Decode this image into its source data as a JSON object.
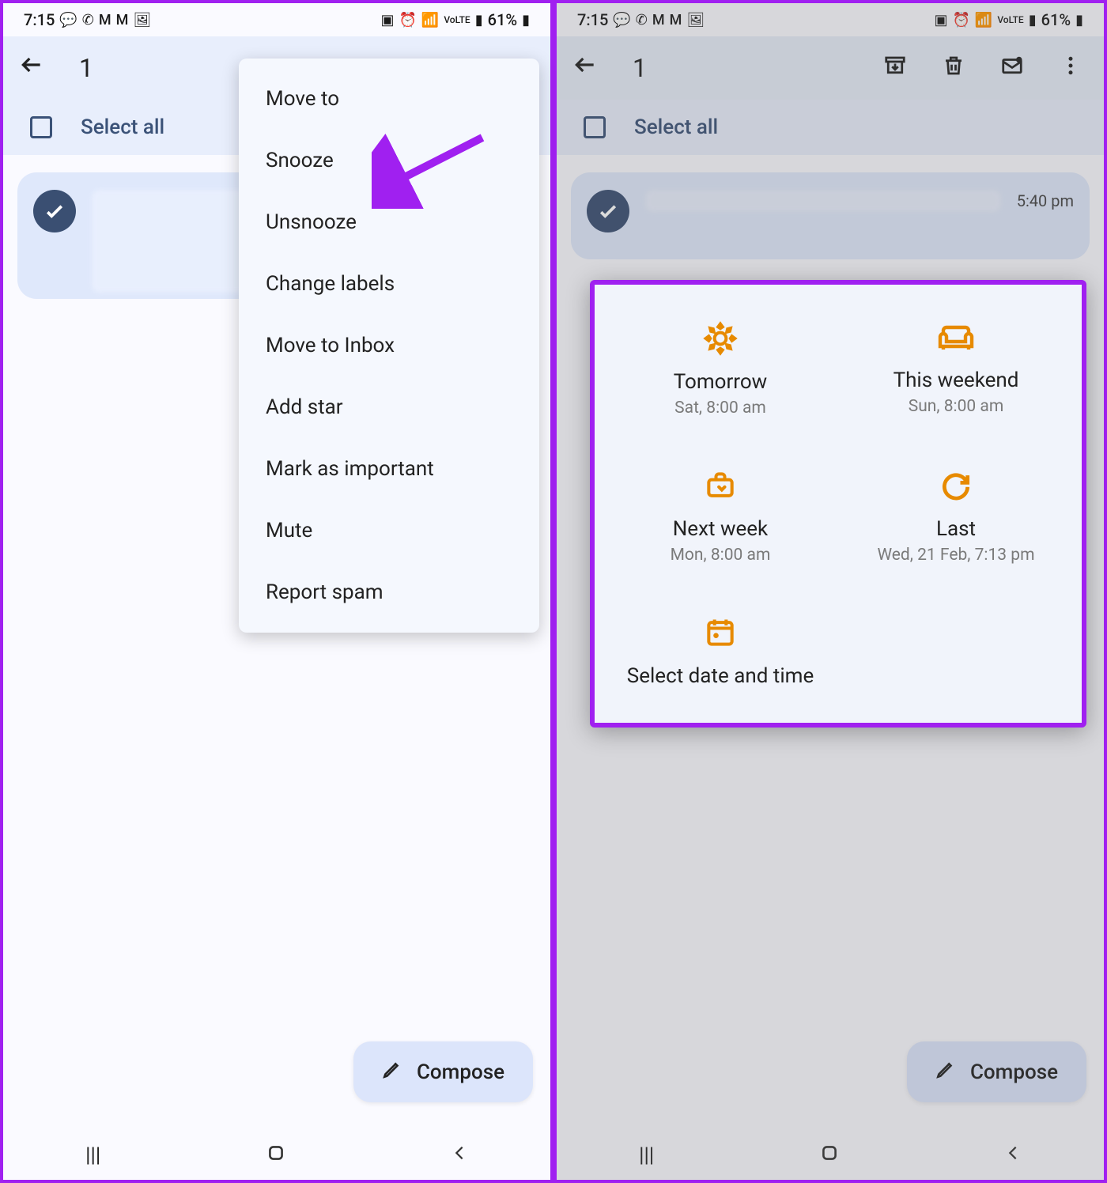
{
  "status": {
    "time": "7:15",
    "battery": "61%"
  },
  "appbar": {
    "count": "1"
  },
  "select": {
    "all": "Select all"
  },
  "email": {
    "time": "5:40 pm"
  },
  "menu": {
    "move_to": "Move to",
    "snooze": "Snooze",
    "unsnooze": "Unsnooze",
    "change_labels": "Change labels",
    "move_to_inbox": "Move to Inbox",
    "add_star": "Add star",
    "mark_important": "Mark as important",
    "mute": "Mute",
    "report_spam": "Report spam"
  },
  "compose": {
    "label": "Compose"
  },
  "snooze_dialog": {
    "tomorrow": {
      "title": "Tomorrow",
      "sub": "Sat, 8:00 am"
    },
    "weekend": {
      "title": "This weekend",
      "sub": "Sun, 8:00 am"
    },
    "next_week": {
      "title": "Next week",
      "sub": "Mon, 8:00 am"
    },
    "last": {
      "title": "Last",
      "sub": "Wed, 21 Feb, 7:13 pm"
    },
    "custom": {
      "title": "Select date and time"
    }
  }
}
